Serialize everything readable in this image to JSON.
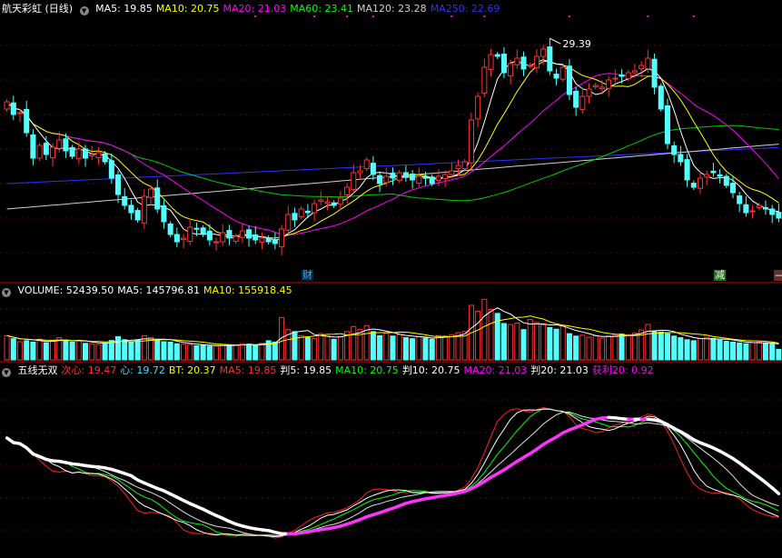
{
  "price_panel": {
    "title": "航天彩虹 (日线)",
    "ma_labels": [
      {
        "text": "MA5: 19.85",
        "color": "#ffffff"
      },
      {
        "text": "MA10: 20.75",
        "color": "#ffff00"
      },
      {
        "text": "MA20: 21.03",
        "color": "#ff00ff"
      },
      {
        "text": "MA60: 23.41",
        "color": "#00ff00"
      },
      {
        "text": "MA120: 23.28",
        "color": "#d0d0d0"
      },
      {
        "text": "MA250: 22.69",
        "color": "#3030ff"
      }
    ],
    "peak_label": "29.39",
    "events": [
      {
        "text": "财",
        "color": "#00ccff",
        "bg": "#102040"
      },
      {
        "text": "减",
        "color": "#e0ffe0",
        "bg": "#207020"
      },
      {
        "text": "—",
        "color": "#ffffff",
        "bg": "#603030"
      }
    ]
  },
  "volume_panel": {
    "labels": [
      {
        "text": "VOLUME: 52439.50",
        "color": "#ffffff"
      },
      {
        "text": "MA5: 145796.81",
        "color": "#ffffff"
      },
      {
        "text": "MA10: 155918.45",
        "color": "#ffff00"
      }
    ]
  },
  "indicator_panel": {
    "labels": [
      {
        "text": "五线无双",
        "color": "#ffffff"
      },
      {
        "text": "次心: 19.47",
        "color": "#ff3030"
      },
      {
        "text": "心: 19.72",
        "color": "#40e0ff"
      },
      {
        "text": "BT: 20.37",
        "color": "#ffff00"
      },
      {
        "text": "MA5: 19.85",
        "color": "#ff3030"
      },
      {
        "text": "判5: 19.85",
        "color": "#ffffff"
      },
      {
        "text": "MA10: 20.75",
        "color": "#00ff00"
      },
      {
        "text": "判10: 20.75",
        "color": "#ffffff"
      },
      {
        "text": "MA20: 21.03",
        "color": "#ff00ff"
      },
      {
        "text": "判20: 21.03",
        "color": "#ffffff"
      },
      {
        "text": "获利20: 0.92",
        "color": "#ff00ff"
      }
    ]
  },
  "chart_data": {
    "type": "candlestick",
    "price_range": [
      16.5,
      30.2
    ],
    "closes": [
      25.5,
      24.8,
      24.9,
      23.8,
      22.4,
      23.1,
      22.6,
      23.0,
      23.4,
      22.8,
      22.5,
      22.9,
      22.4,
      22.6,
      22.7,
      22.2,
      21.3,
      20.4,
      19.8,
      19.4,
      19.0,
      20.3,
      20.7,
      19.6,
      18.9,
      18.2,
      17.8,
      18.0,
      18.6,
      18.5,
      18.2,
      17.9,
      17.8,
      18.3,
      18.0,
      18.1,
      18.4,
      18.0,
      17.9,
      18.0,
      17.8,
      17.7,
      18.5,
      19.3,
      19.0,
      19.6,
      19.4,
      19.9,
      20.1,
      20.0,
      19.8,
      20.2,
      20.8,
      21.6,
      21.7,
      22.3,
      21.5,
      21.0,
      21.4,
      21.3,
      21.6,
      21.4,
      21.2,
      21.4,
      21.3,
      21.0,
      21.4,
      21.5,
      21.7,
      22.0,
      22.2,
      24.5,
      25.8,
      27.4,
      28.1,
      28.0,
      27.1,
      27.6,
      27.9,
      27.3,
      27.5,
      28.0,
      28.4,
      27.2,
      26.8,
      27.4,
      25.9,
      25.2,
      25.8,
      26.2,
      26.4,
      26.3,
      26.7,
      26.8,
      26.9,
      27.1,
      27.2,
      27.5,
      27.9,
      26.3,
      25.1,
      23.2,
      22.6,
      22.2,
      21.2,
      20.8,
      21.3,
      21.5,
      21.6,
      21.4,
      20.9,
      20.5,
      19.9,
      19.4,
      19.5,
      19.8,
      19.6,
      19.3,
      19.1
    ],
    "volume": [
      120000,
      105000,
      90000,
      95000,
      88000,
      102000,
      85000,
      92000,
      110000,
      98000,
      88000,
      95000,
      82000,
      80000,
      76000,
      84000,
      96000,
      115000,
      100000,
      90000,
      98000,
      120000,
      110000,
      95000,
      90000,
      88000,
      80000,
      78000,
      76000,
      70000,
      72000,
      68000,
      70000,
      76000,
      72000,
      74000,
      80000,
      78000,
      73000,
      82000,
      95000,
      88000,
      210000,
      150000,
      140000,
      120000,
      110000,
      105000,
      130000,
      118000,
      102000,
      115000,
      140000,
      165000,
      150000,
      170000,
      140000,
      120000,
      132000,
      118000,
      126000,
      110000,
      105000,
      115000,
      108000,
      102000,
      120000,
      118000,
      125000,
      135000,
      140000,
      270000,
      240000,
      300000,
      250000,
      230000,
      180000,
      175000,
      182000,
      150000,
      200000,
      185000,
      172000,
      160000,
      152000,
      168000,
      130000,
      118000,
      122000,
      112000,
      120000,
      108000,
      118000,
      122000,
      128000,
      125000,
      132000,
      148000,
      175000,
      140000,
      138000,
      130000,
      118000,
      110000,
      100000,
      95000,
      105000,
      112000,
      106000,
      98000,
      92000,
      88000,
      84000,
      80000,
      86000,
      88000,
      84000,
      80000,
      52439.5
    ],
    "indicator_range": [
      16.5,
      30.2
    ]
  }
}
